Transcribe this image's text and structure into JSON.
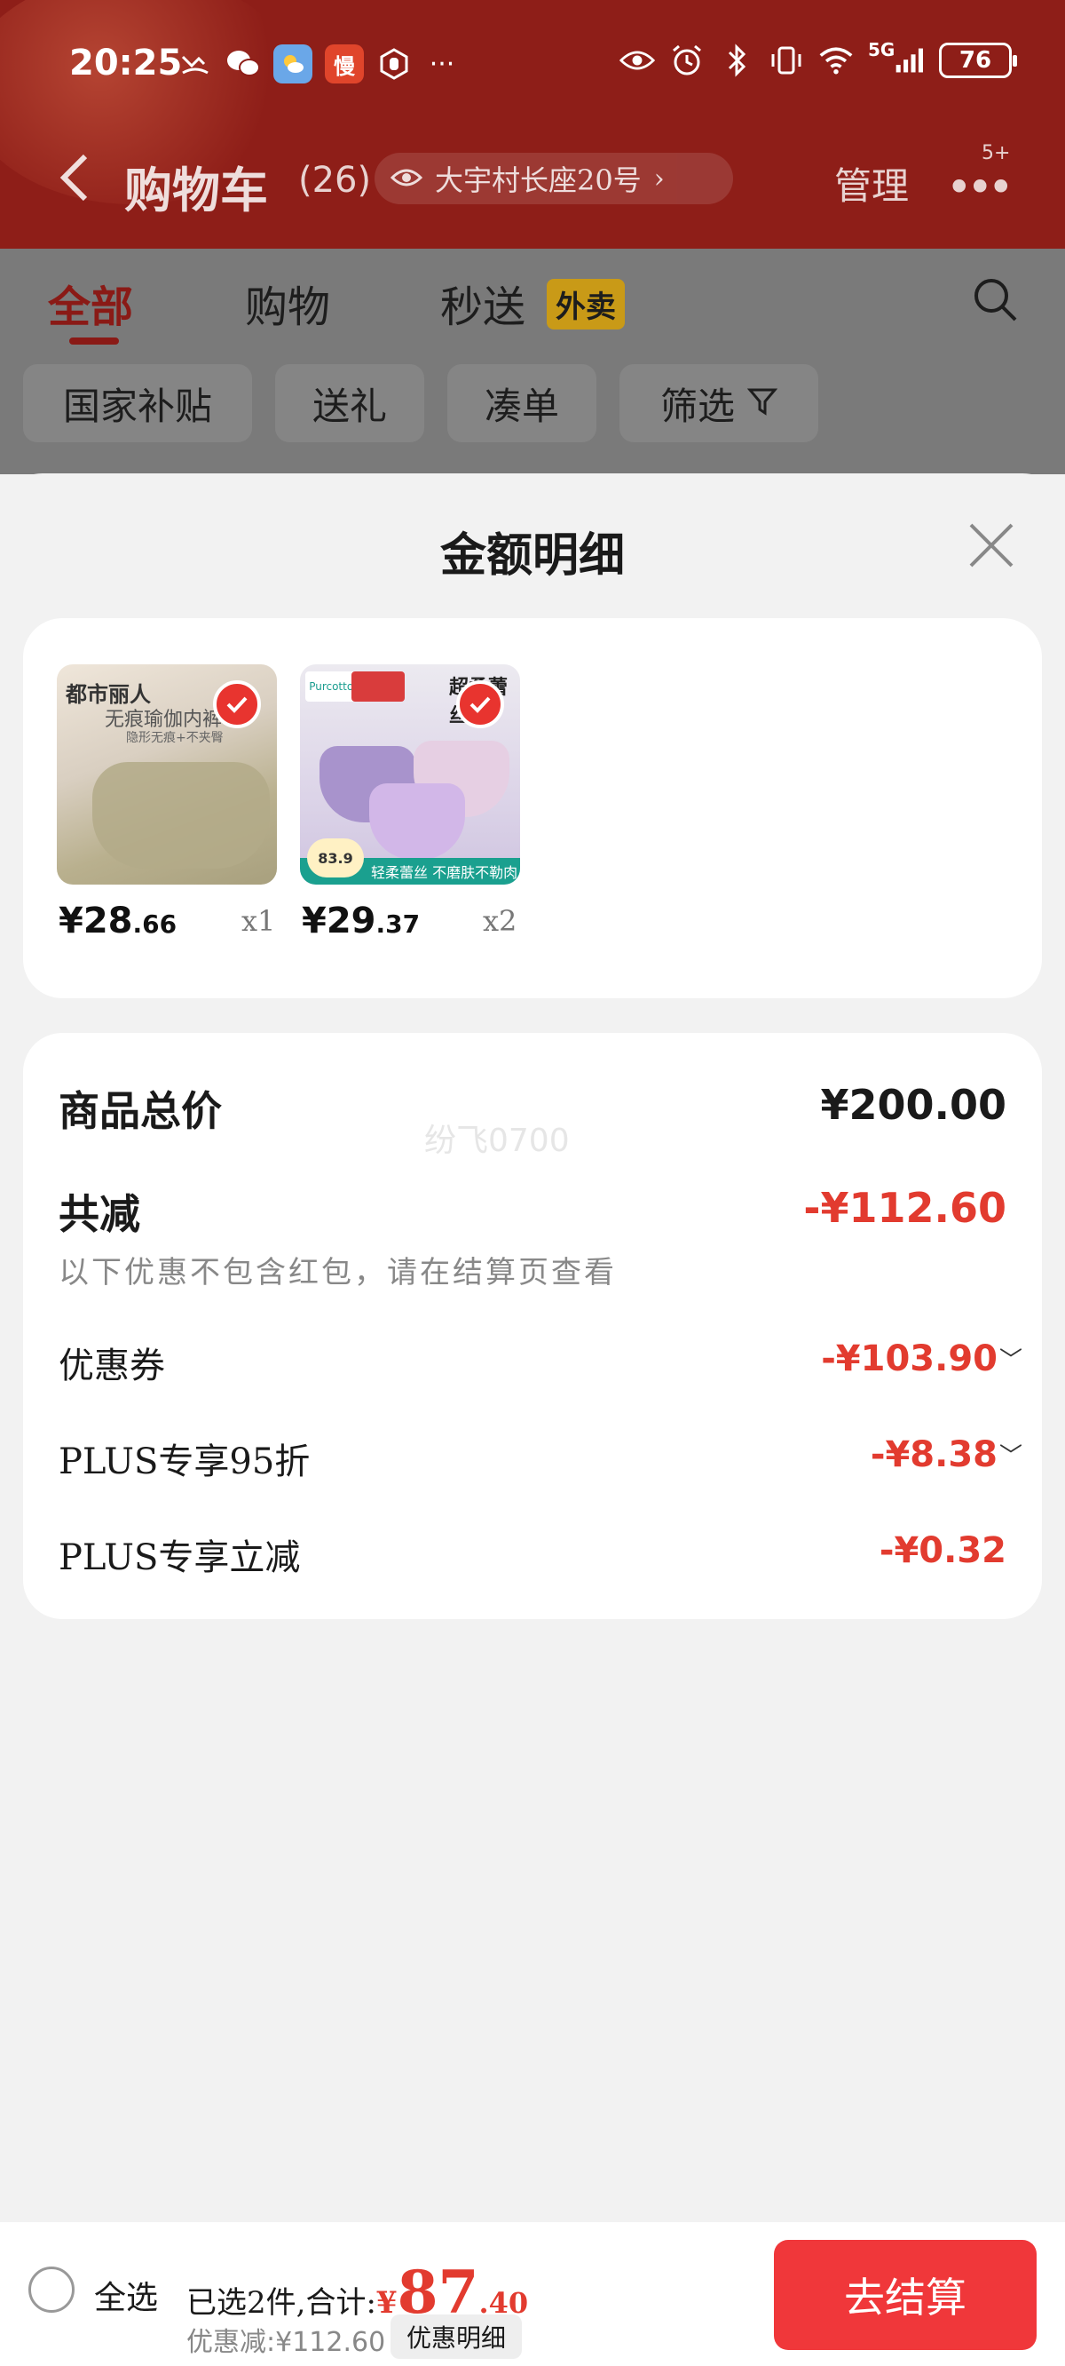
{
  "status_bar": {
    "time": "20:25",
    "network": "5G",
    "battery": "76",
    "left_icons": [
      "missed-call-icon",
      "wechat-icon",
      "weather-icon",
      "app-man-icon",
      "hand-icon",
      "more-dots-icon"
    ],
    "right_icons": [
      "eye-icon",
      "alarm-icon",
      "bluetooth-icon",
      "vibrate-icon",
      "wifi-icon",
      "signal-icon"
    ]
  },
  "header": {
    "title": "购物车",
    "count": "(26)",
    "address": "大宇村长座20号",
    "manage": "管理",
    "more_badge": "5+"
  },
  "tabs": [
    {
      "label": "全部",
      "active": true
    },
    {
      "label": "购物",
      "active": false
    },
    {
      "label": "秒送",
      "active": false,
      "tag": "外卖"
    }
  ],
  "chips": [
    "国家补贴",
    "送礼",
    "凑单",
    "筛选"
  ],
  "sheet": {
    "title": "金额明细",
    "products": [
      {
        "price_int": "¥28",
        "price_dec": ".66",
        "qty": "x1",
        "brand": "都市丽人",
        "caption": "无痕瑜伽内裤",
        "sub": "隐形无痕+不夹臀",
        "accent": "#b3aa88"
      },
      {
        "price_int": "¥29",
        "price_dec": ".37",
        "qty": "x2",
        "brand": "Purcotton",
        "headline": "超柔蕾丝",
        "badge_price": "83.9",
        "strip": "轻柔蕾丝 不磨肤不勒肉",
        "accent": "#b9a7d8"
      }
    ],
    "summary": {
      "watermark": "纷飞0700",
      "total_label": "商品总价",
      "total_value": "¥200.00",
      "reduce_label": "共减",
      "reduce_value": "-¥112.60",
      "note": "以下优惠不包含红包，请在结算页查看",
      "rows": [
        {
          "label": "优惠券",
          "value": "-¥103.90",
          "expandable": true
        },
        {
          "label": "PLUS专享95折",
          "value": "-¥8.38",
          "expandable": true
        },
        {
          "label": "PLUS专享立减",
          "value": "-¥0.32",
          "expandable": false
        }
      ]
    }
  },
  "bottom": {
    "select_all": "全选",
    "selected_text": "已选2件,合计:",
    "currency": "¥",
    "total_int": "87",
    "total_dec": ".40",
    "discount_text": "优惠减:¥112.60",
    "detail_button": "优惠明细",
    "checkout": "去结算"
  },
  "colors": {
    "header_red": "#8e1e18",
    "accent_red": "#e23b2f",
    "checkout_red": "#f0373a",
    "waimai_yellow": "#c99a17"
  }
}
